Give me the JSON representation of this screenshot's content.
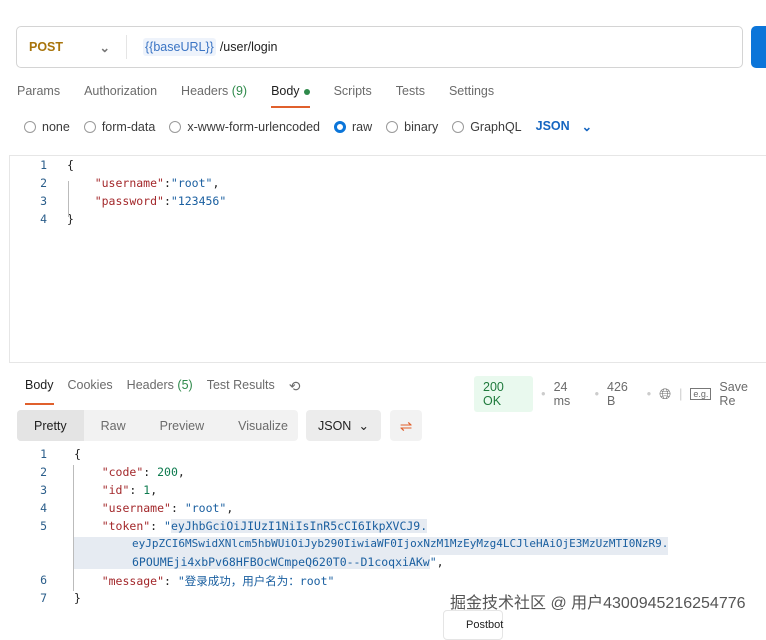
{
  "request": {
    "method": "POST",
    "url_variable": "{{baseURL}}",
    "url_path": "/user/login"
  },
  "request_tabs": [
    {
      "label": "Params"
    },
    {
      "label": "Authorization"
    },
    {
      "label": "Headers",
      "count": "(9)"
    },
    {
      "label": "Body"
    },
    {
      "label": "Scripts"
    },
    {
      "label": "Tests"
    },
    {
      "label": "Settings"
    }
  ],
  "body_types": [
    "none",
    "form-data",
    "x-www-form-urlencoded",
    "raw",
    "binary",
    "GraphQL"
  ],
  "body_type_selected": "raw",
  "body_format": "JSON",
  "request_body": {
    "lines": [
      "1",
      "2",
      "3",
      "4"
    ],
    "brace_open": "{",
    "brace_close": "}",
    "k1": "\"username\"",
    "v1": "\"root\"",
    "k2": "\"password\"",
    "v2": "\"123456\""
  },
  "response_tabs": [
    {
      "label": "Body"
    },
    {
      "label": "Cookies"
    },
    {
      "label": "Headers",
      "count": "(5)"
    },
    {
      "label": "Test Results"
    }
  ],
  "response_status": {
    "code": "200 OK",
    "time": "24 ms",
    "size": "426 B",
    "save_label": "Save Re"
  },
  "view_modes": [
    "Pretty",
    "Raw",
    "Preview",
    "Visualize"
  ],
  "response_format": "JSON",
  "response_body": {
    "lines": [
      "1",
      "2",
      "3",
      "4",
      "5",
      "6",
      "7"
    ],
    "k_code": "\"code\"",
    "v_code": "200",
    "k_id": "\"id\"",
    "v_id": "1",
    "k_user": "\"username\"",
    "v_user": "\"root\"",
    "k_token": "\"token\"",
    "token_1": "eyJhbGciOiJIUzI1NiIsInR5cCI6IkpXVCJ9.",
    "token_2": "eyJpZCI6MSwidXNlcm5hbWUiOiJyb290IiwiaWF0IjoxNzM1MzEyMzg4LCJleHAiOjE3MzUzMTI0NzR9.",
    "token_3": "6POUMEji4xbPv68HFBOcWCmpeQ620T0--D1coqxiAKw",
    "k_msg": "\"message\"",
    "v_msg": "\"登录成功，用户名为：root\""
  },
  "watermark": "掘金技术社区 @ 用户4300945216254776",
  "popup_label": "Postbot"
}
